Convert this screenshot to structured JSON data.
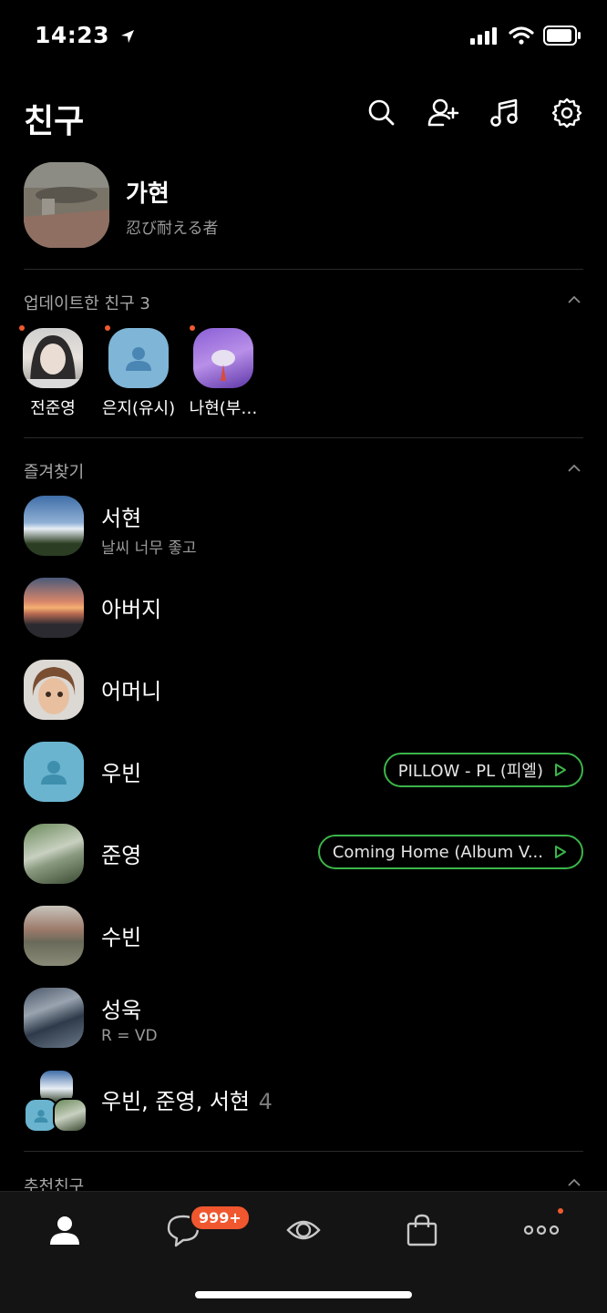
{
  "status_bar": {
    "time": "14:23"
  },
  "header": {
    "title": "친구",
    "icons": [
      "search-icon",
      "add-friend-icon",
      "music-icon",
      "settings-icon"
    ]
  },
  "profile": {
    "name": "가현",
    "status": "忍び耐える者"
  },
  "updated_section": {
    "title": "업데이트한 친구 3",
    "friends": [
      {
        "name": "전준영"
      },
      {
        "name": "은지(유시)"
      },
      {
        "name": "나현(부…"
      }
    ]
  },
  "favorites_section": {
    "title": "즐겨찾기",
    "friends": [
      {
        "name": "서현",
        "status": "날씨 너무 좋고"
      },
      {
        "name": "아버지"
      },
      {
        "name": "어머니"
      },
      {
        "name": "우빈",
        "music": "PILLOW - PL (피엘)"
      },
      {
        "name": "준영",
        "music": "Coming Home (Album V..."
      },
      {
        "name": "수빈"
      },
      {
        "name": "성욱",
        "status": "R = VD"
      },
      {
        "name": "우빈, 준영, 서현",
        "count": "4"
      }
    ]
  },
  "recommended_section": {
    "title": "추천친구"
  },
  "tabbar": {
    "tabs": [
      "friends-tab",
      "chats-tab",
      "view-tab",
      "shopping-tab",
      "more-tab"
    ],
    "chat_badge": "999+"
  },
  "colors": {
    "accent_green": "#3bb54a",
    "badge_orange": "#f0572f",
    "background": "#000000"
  }
}
